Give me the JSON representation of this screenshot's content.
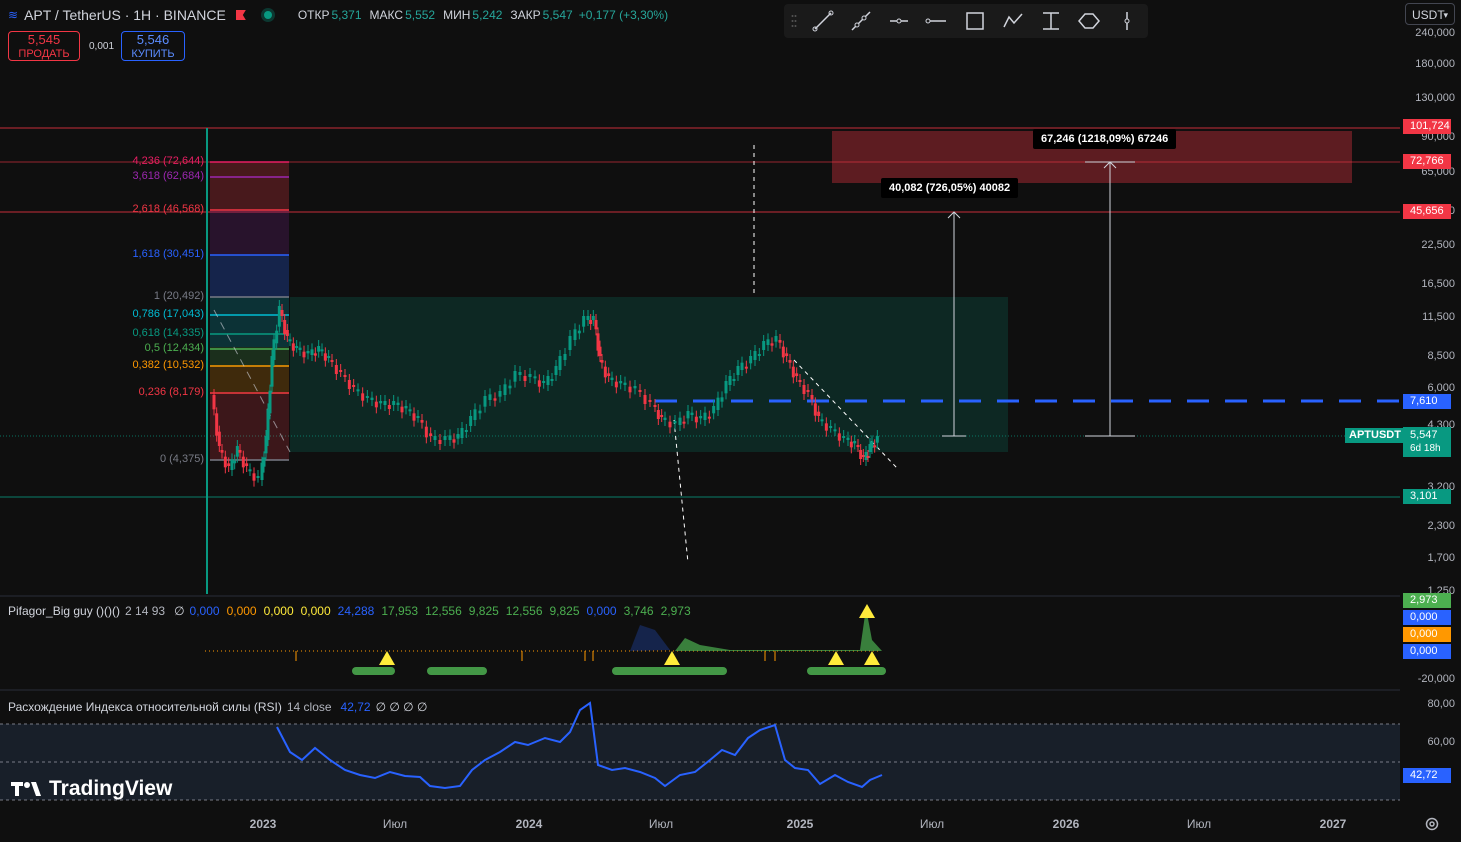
{
  "header": {
    "symbol": "APT / TetherUS · 1H · BINANCE",
    "open_label": "ОТКР",
    "open": "5,371",
    "high_label": "МАКС",
    "high": "5,552",
    "low_label": "МИН",
    "low": "5,242",
    "close_label": "ЗАКР",
    "close": "5,547",
    "change": "+0,177 (+3,30%)"
  },
  "trade": {
    "sell_price": "5,545",
    "sell_label": "ПРОДАТЬ",
    "spread": "0,001",
    "buy_price": "5,546",
    "buy_label": "КУПИТЬ"
  },
  "currency": "USDT",
  "toolbar_icons": [
    "drag-handle-icon",
    "trend-line-icon",
    "ray-icon",
    "horizontal-ray-icon",
    "horizontal-line-icon",
    "rectangle-icon",
    "path-icon",
    "fib-icon",
    "ellipse-icon",
    "vertical-line-icon"
  ],
  "price_axis": [
    "240,000",
    "180,000",
    "130,000",
    "90,000",
    "65,000",
    "45,656",
    "32,500",
    "22,500",
    "16,500",
    "11,500",
    "8,500",
    "6,000",
    "4,300",
    "3,200",
    "2,300",
    "1,700",
    "1,250"
  ],
  "price_tags": {
    "t1": "101,724",
    "t2": "72,766",
    "t3": "45,656",
    "t4": "7,610",
    "last": "5,547",
    "countdown": "6d 18h",
    "t6": "3,101",
    "symbol_tag": "APTUSDT"
  },
  "fib_levels": [
    {
      "label": "4,236 (72,644)",
      "color": "#e91e63"
    },
    {
      "label": "3,618 (62,684)",
      "color": "#9c27b0"
    },
    {
      "label": "2,618 (46,568)",
      "color": "#f23645"
    },
    {
      "label": "1,618 (30,451)",
      "color": "#2962ff"
    },
    {
      "label": "1 (20,492)",
      "color": "#787b86"
    },
    {
      "label": "0,786 (17,043)",
      "color": "#00bcd4"
    },
    {
      "label": "0,618 (14,335)",
      "color": "#089981"
    },
    {
      "label": "0,5 (12,434)",
      "color": "#4caf50"
    },
    {
      "label": "0,382 (10,532)",
      "color": "#ff9800"
    },
    {
      "label": "0,236 (8,179)",
      "color": "#f23645"
    },
    {
      "label": "0 (4,375)",
      "color": "#787b86"
    }
  ],
  "measure_callouts": {
    "a": "40,082 (726,05%) 40082",
    "b": "67,246 (1218,09%) 67246"
  },
  "indicator1": {
    "name": "Pifagor_Big guy ()()()",
    "params": "2 14 93",
    "null_sym": "∅",
    "values": [
      {
        "v": "0,000",
        "color": "#2962ff"
      },
      {
        "v": "0,000",
        "color": "#ff9800"
      },
      {
        "v": "0,000",
        "color": "#ffeb3b"
      },
      {
        "v": "0,000",
        "color": "#ffeb3b"
      },
      {
        "v": "24,288",
        "color": "#2962ff"
      },
      {
        "v": "17,953",
        "color": "#4caf50"
      },
      {
        "v": "12,556",
        "color": "#4caf50"
      },
      {
        "v": "9,825",
        "color": "#4caf50"
      },
      {
        "v": "12,556",
        "color": "#4caf50"
      },
      {
        "v": "9,825",
        "color": "#4caf50"
      },
      {
        "v": "0,000",
        "color": "#2962ff"
      },
      {
        "v": "3,746",
        "color": "#4caf50"
      },
      {
        "v": "2,973",
        "color": "#4caf50"
      }
    ],
    "axis_tags": [
      "2,973",
      "0,000",
      "0,000",
      "0,000"
    ],
    "axis_low": "-20,000"
  },
  "indicator2": {
    "name": "Расхождение Индекса относительной силы (RSI)",
    "params": "14 close",
    "value": "42,72",
    "nulls": "∅ ∅ ∅ ∅",
    "axis": [
      "80,00",
      "60,00"
    ],
    "tag": "42,72"
  },
  "time_axis": [
    "2023",
    "Июл",
    "2024",
    "Июл",
    "2025",
    "Июл",
    "2026",
    "Июл",
    "2027"
  ],
  "brand": "TradingView",
  "colors": {
    "up": "#089981",
    "down": "#f23645",
    "accent": "#2962ff"
  }
}
